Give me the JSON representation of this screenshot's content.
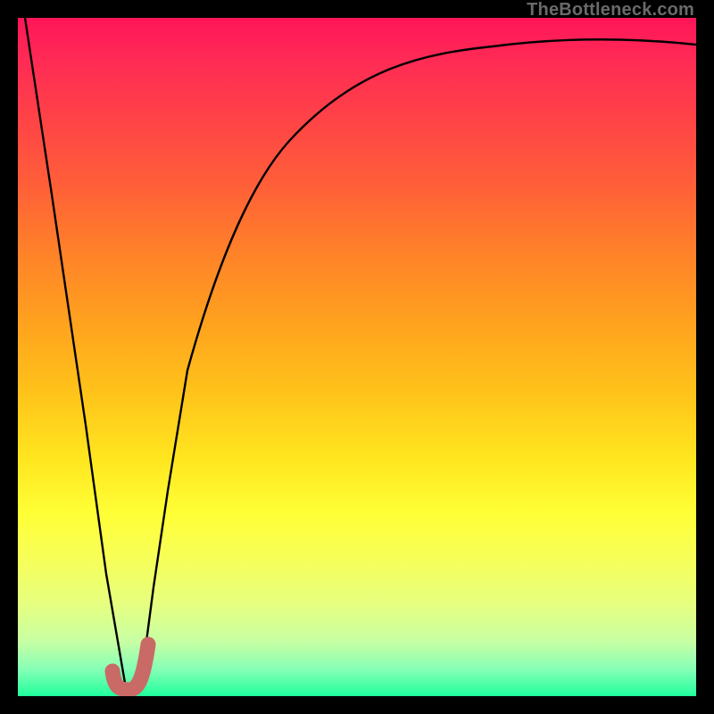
{
  "watermark": "TheBottleneck.com",
  "colors": {
    "frame": "#000000",
    "curve_stroke": "#000000",
    "marker_fill": "#c96a67",
    "marker_stroke": "#c96a67"
  },
  "chart_data": {
    "type": "line",
    "title": "",
    "xlabel": "",
    "ylabel": "",
    "xlim": [
      0,
      100
    ],
    "ylim": [
      0,
      100
    ],
    "series": [
      {
        "name": "bottleneck-curve",
        "x": [
          1,
          5,
          10,
          13,
          16,
          18,
          20,
          22,
          25,
          30,
          35,
          40,
          50,
          60,
          70,
          80,
          90,
          100
        ],
        "y": [
          100,
          74,
          40,
          18,
          1,
          1,
          16,
          30,
          48,
          66,
          76,
          82,
          89,
          92,
          94,
          95,
          95.5,
          96
        ]
      }
    ],
    "marker": {
      "name": "optimal-range",
      "path_xy": [
        [
          14.0,
          3.5
        ],
        [
          14.5,
          1.0
        ],
        [
          16.5,
          0.8
        ],
        [
          18.2,
          2.2
        ],
        [
          19.2,
          7.5
        ]
      ]
    },
    "gradient_stops": [
      {
        "pct": 0,
        "color": "#ff1559"
      },
      {
        "pct": 14,
        "color": "#ff4048"
      },
      {
        "pct": 35,
        "color": "#ff8328"
      },
      {
        "pct": 55,
        "color": "#ffc21a"
      },
      {
        "pct": 73,
        "color": "#ffff36"
      },
      {
        "pct": 92,
        "color": "#c7ffa4"
      },
      {
        "pct": 100,
        "color": "#20ff9c"
      }
    ]
  }
}
